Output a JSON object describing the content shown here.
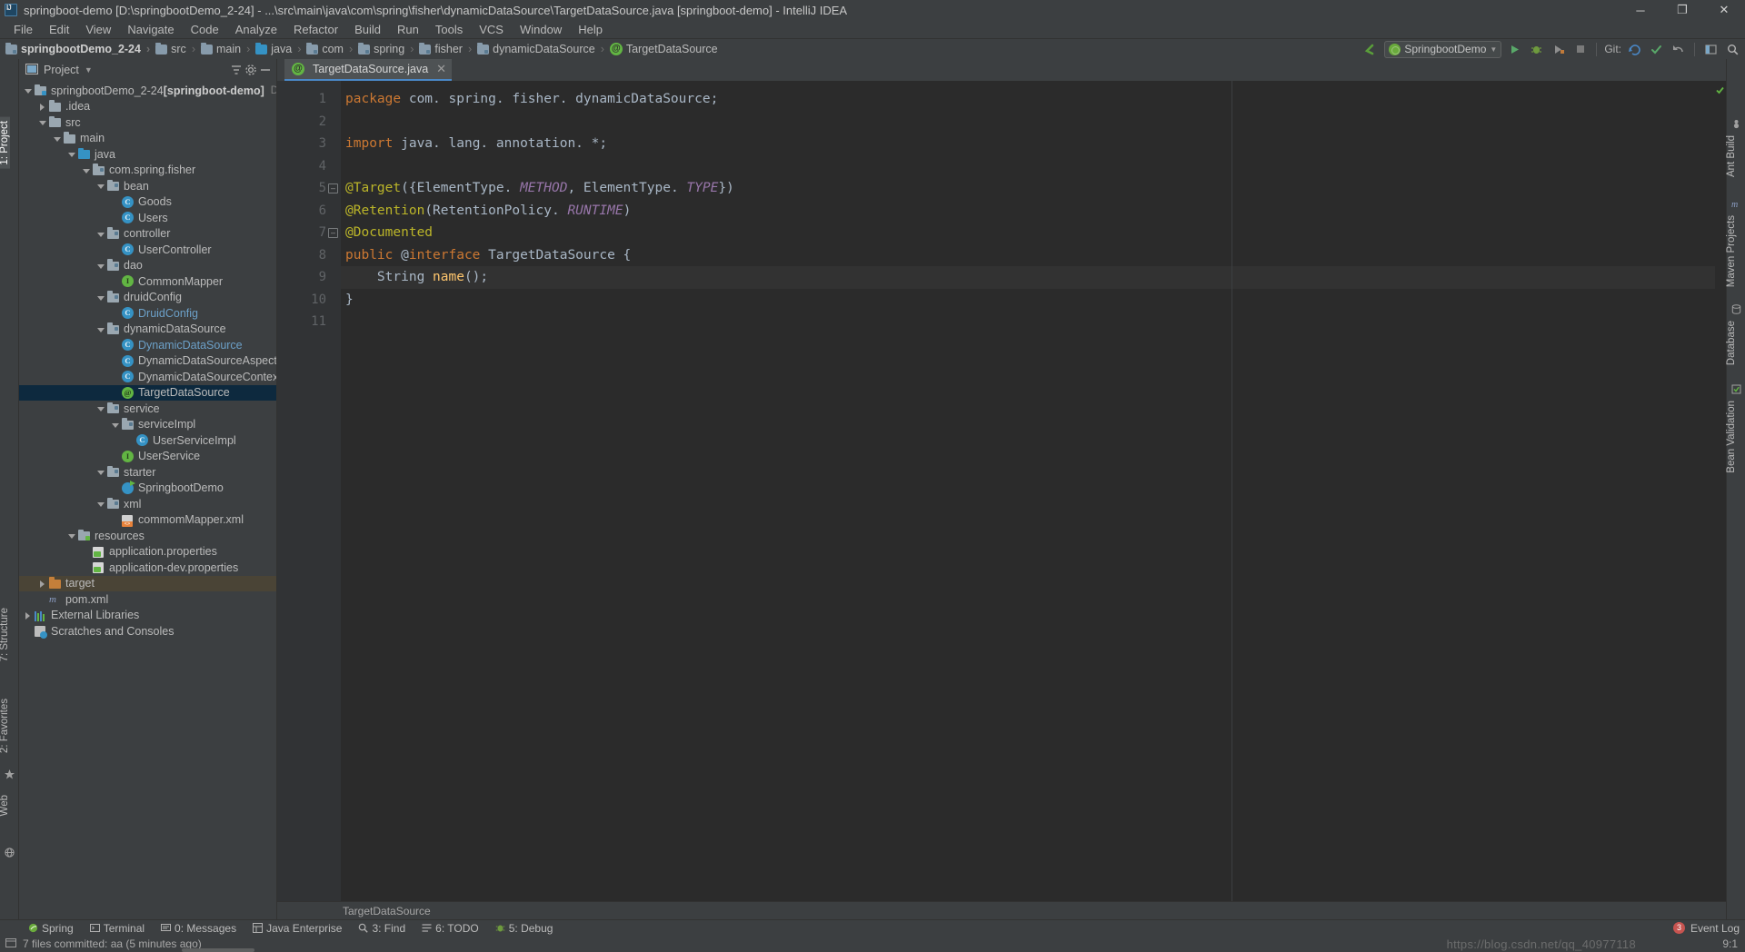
{
  "window": {
    "title": "springboot-demo [D:\\springbootDemo_2-24] - ...\\src\\main\\java\\com\\spring\\fisher\\dynamicDataSource\\TargetDataSource.java [springboot-demo] - IntelliJ IDEA",
    "minimize": "─",
    "maximize": "❐",
    "close": "✕"
  },
  "menu": [
    {
      "label": "File"
    },
    {
      "label": "Edit"
    },
    {
      "label": "View"
    },
    {
      "label": "Navigate"
    },
    {
      "label": "Code"
    },
    {
      "label": "Analyze"
    },
    {
      "label": "Refactor"
    },
    {
      "label": "Build"
    },
    {
      "label": "Run"
    },
    {
      "label": "Tools"
    },
    {
      "label": "VCS"
    },
    {
      "label": "Window"
    },
    {
      "label": "Help"
    }
  ],
  "navbar": {
    "crumbs": [
      {
        "label": "springbootDemo_2-24",
        "icon": "module-folder-icon"
      },
      {
        "label": "src",
        "icon": "folder-icon"
      },
      {
        "label": "main",
        "icon": "folder-icon"
      },
      {
        "label": "java",
        "icon": "source-folder-icon"
      },
      {
        "label": "com",
        "icon": "package-icon"
      },
      {
        "label": "spring",
        "icon": "package-icon"
      },
      {
        "label": "fisher",
        "icon": "package-icon"
      },
      {
        "label": "dynamicDataSource",
        "icon": "package-icon"
      },
      {
        "label": "TargetDataSource",
        "icon": "annotation-icon"
      }
    ],
    "run_config": "SpringbootDemo",
    "git_label": "Git:"
  },
  "sidebar_left": {
    "project_label": "1: Project",
    "structure_label": "7: Structure",
    "favorites_label": "2: Favorites",
    "web_label": "Web"
  },
  "sidebar_right": {
    "ant_label": "Ant Build",
    "maven_label": "Maven Projects",
    "database_label": "Database",
    "bean_label": "Bean Validation"
  },
  "project_panel": {
    "title": "Project",
    "collapse_icon": "collapse-all-icon",
    "settings_icon": "gear-icon",
    "hide_icon": "hide-icon",
    "tree": [
      {
        "indent": 0,
        "arrow": "down",
        "icon": "module-folder-icon",
        "label": "springbootDemo_2-24",
        "bold_suffix": " [springboot-demo]",
        "dim": "D:\\spring",
        "state": "normal"
      },
      {
        "indent": 1,
        "arrow": "right",
        "icon": "folder-icon",
        "label": ".idea",
        "state": "normal"
      },
      {
        "indent": 1,
        "arrow": "down",
        "icon": "folder-icon",
        "label": "src",
        "state": "normal"
      },
      {
        "indent": 2,
        "arrow": "down",
        "icon": "folder-icon",
        "label": "main",
        "state": "normal"
      },
      {
        "indent": 3,
        "arrow": "down",
        "icon": "source-folder-icon",
        "label": "java",
        "state": "normal"
      },
      {
        "indent": 4,
        "arrow": "down",
        "icon": "package-icon",
        "label": "com.spring.fisher",
        "state": "normal"
      },
      {
        "indent": 5,
        "arrow": "down",
        "icon": "package-icon",
        "label": "bean",
        "state": "normal"
      },
      {
        "indent": 6,
        "arrow": "none",
        "icon": "class-icon",
        "label": "Goods",
        "state": "normal"
      },
      {
        "indent": 6,
        "arrow": "none",
        "icon": "class-icon",
        "label": "Users",
        "state": "normal"
      },
      {
        "indent": 5,
        "arrow": "down",
        "icon": "package-icon",
        "label": "controller",
        "state": "normal"
      },
      {
        "indent": 6,
        "arrow": "none",
        "icon": "class-icon",
        "label": "UserController",
        "state": "normal"
      },
      {
        "indent": 5,
        "arrow": "down",
        "icon": "package-icon",
        "label": "dao",
        "state": "normal"
      },
      {
        "indent": 6,
        "arrow": "none",
        "icon": "interface-icon",
        "label": "CommonMapper",
        "state": "normal"
      },
      {
        "indent": 5,
        "arrow": "down",
        "icon": "package-icon",
        "label": "druidConfig",
        "state": "normal"
      },
      {
        "indent": 6,
        "arrow": "none",
        "icon": "class-icon",
        "label": "DruidConfig",
        "state": "blue"
      },
      {
        "indent": 5,
        "arrow": "down",
        "icon": "package-icon",
        "label": "dynamicDataSource",
        "state": "normal"
      },
      {
        "indent": 6,
        "arrow": "none",
        "icon": "class-icon",
        "label": "DynamicDataSource",
        "state": "blue"
      },
      {
        "indent": 6,
        "arrow": "none",
        "icon": "class-icon",
        "label": "DynamicDataSourceAspect",
        "state": "normal"
      },
      {
        "indent": 6,
        "arrow": "none",
        "icon": "class-icon",
        "label": "DynamicDataSourceContextHolder",
        "state": "normal"
      },
      {
        "indent": 6,
        "arrow": "none",
        "icon": "annotation-icon",
        "label": "TargetDataSource",
        "state": "selected"
      },
      {
        "indent": 5,
        "arrow": "down",
        "icon": "package-icon",
        "label": "service",
        "state": "normal"
      },
      {
        "indent": 6,
        "arrow": "down",
        "icon": "package-icon",
        "label": "serviceImpl",
        "state": "normal"
      },
      {
        "indent": 7,
        "arrow": "none",
        "icon": "class-icon",
        "label": "UserServiceImpl",
        "state": "normal"
      },
      {
        "indent": 6,
        "arrow": "none",
        "icon": "interface-icon",
        "label": "UserService",
        "state": "normal"
      },
      {
        "indent": 5,
        "arrow": "down",
        "icon": "package-icon",
        "label": "starter",
        "state": "normal"
      },
      {
        "indent": 6,
        "arrow": "none",
        "icon": "spring-boot-icon",
        "label": "SpringbootDemo",
        "state": "normal"
      },
      {
        "indent": 5,
        "arrow": "down",
        "icon": "package-icon",
        "label": "xml",
        "state": "normal"
      },
      {
        "indent": 6,
        "arrow": "none",
        "icon": "xml-file-icon",
        "label": "commomMapper.xml",
        "state": "normal"
      },
      {
        "indent": 3,
        "arrow": "down",
        "icon": "resource-folder-icon",
        "label": "resources",
        "state": "normal"
      },
      {
        "indent": 4,
        "arrow": "none",
        "icon": "properties-icon",
        "label": "application.properties",
        "state": "normal"
      },
      {
        "indent": 4,
        "arrow": "none",
        "icon": "properties-icon",
        "label": "application-dev.properties",
        "state": "normal"
      },
      {
        "indent": 1,
        "arrow": "right",
        "icon": "target-folder-icon",
        "label": "target",
        "state": "highlight"
      },
      {
        "indent": 1,
        "arrow": "none",
        "icon": "maven-icon",
        "label": "pom.xml",
        "state": "normal"
      },
      {
        "indent": 0,
        "arrow": "right",
        "icon": "library-icon",
        "label": "External Libraries",
        "state": "normal"
      },
      {
        "indent": 0,
        "arrow": "none",
        "icon": "scratch-icon",
        "label": "Scratches and Consoles",
        "state": "normal"
      }
    ]
  },
  "editor": {
    "tab": {
      "label": "TargetDataSource.java",
      "icon": "annotation-icon",
      "close": "✕"
    },
    "breadcrumb_footer": "TargetDataSource",
    "lines": [
      "1",
      "2",
      "3",
      "4",
      "5",
      "6",
      "7",
      "8",
      "9",
      "10",
      "11"
    ],
    "code": [
      {
        "n": 1,
        "tokens": [
          {
            "t": "package",
            "c": "k-kw"
          },
          {
            "t": " com. spring. fisher. dynamicDataSource",
            "c": "k-def"
          },
          {
            "t": ";",
            "c": "k-punc"
          }
        ]
      },
      {
        "n": 2,
        "tokens": []
      },
      {
        "n": 3,
        "tokens": [
          {
            "t": "import",
            "c": "k-kw"
          },
          {
            "t": " java. lang. annotation. *",
            "c": "k-def"
          },
          {
            "t": ";",
            "c": "k-punc"
          }
        ]
      },
      {
        "n": 4,
        "tokens": []
      },
      {
        "n": 5,
        "tokens": [
          {
            "t": "@Target",
            "c": "k-ann"
          },
          {
            "t": "({ElementType. ",
            "c": "k-def"
          },
          {
            "t": "METHOD",
            "c": "k-const"
          },
          {
            "t": ", ElementType. ",
            "c": "k-def"
          },
          {
            "t": "TYPE",
            "c": "k-const"
          },
          {
            "t": "})",
            "c": "k-def"
          }
        ]
      },
      {
        "n": 6,
        "tokens": [
          {
            "t": "@Retention",
            "c": "k-ann"
          },
          {
            "t": "(RetentionPolicy. ",
            "c": "k-def"
          },
          {
            "t": "RUNTIME",
            "c": "k-const"
          },
          {
            "t": ")",
            "c": "k-def"
          }
        ]
      },
      {
        "n": 7,
        "tokens": [
          {
            "t": "@Documented",
            "c": "k-ann"
          }
        ]
      },
      {
        "n": 8,
        "tokens": [
          {
            "t": "public ",
            "c": "k-kw"
          },
          {
            "t": "@",
            "c": "k-def"
          },
          {
            "t": "interface",
            "c": "k-kw"
          },
          {
            "t": " TargetDataSource {",
            "c": "k-def"
          }
        ]
      },
      {
        "n": 9,
        "tokens": [
          {
            "t": "    String ",
            "c": "k-def"
          },
          {
            "t": "name",
            "c": "k-meth"
          },
          {
            "t": "()",
            "c": "k-def"
          },
          {
            "t": ";",
            "c": "k-punc"
          }
        ]
      },
      {
        "n": 10,
        "tokens": [
          {
            "t": "}",
            "c": "k-def"
          }
        ]
      },
      {
        "n": 11,
        "tokens": []
      }
    ]
  },
  "bottom_bar": {
    "items": [
      {
        "label": "Spring",
        "icon": "spring-icon"
      },
      {
        "label": "Terminal",
        "icon": "terminal-icon"
      },
      {
        "label": "0: Messages",
        "icon": "messages-icon"
      },
      {
        "label": "Java Enterprise",
        "icon": "java-ee-icon"
      },
      {
        "label": "3: Find",
        "icon": "search-icon"
      },
      {
        "label": "6: TODO",
        "icon": "todo-icon"
      },
      {
        "label": "5: Debug",
        "icon": "debug-icon"
      }
    ],
    "event_log": "Event Log",
    "event_count": "3"
  },
  "status_bar": {
    "message": "7 files committed: aa (5 minutes ago)",
    "position": "9:1",
    "watermark": "https://blog.csdn.net/qq_40977118"
  },
  "colors": {
    "accent": "#4a88c7",
    "selection": "#0d293e",
    "class_icon": "#3592c4",
    "interface_icon": "#62b543",
    "annotation_icon": "#62b543",
    "editor_bg": "#2b2b2b",
    "panel_bg": "#3c3f41",
    "keyword": "#cc7832",
    "annotation_text": "#bbb529",
    "constant": "#9876aa",
    "method": "#ffc66d",
    "error_badge": "#c75450"
  }
}
